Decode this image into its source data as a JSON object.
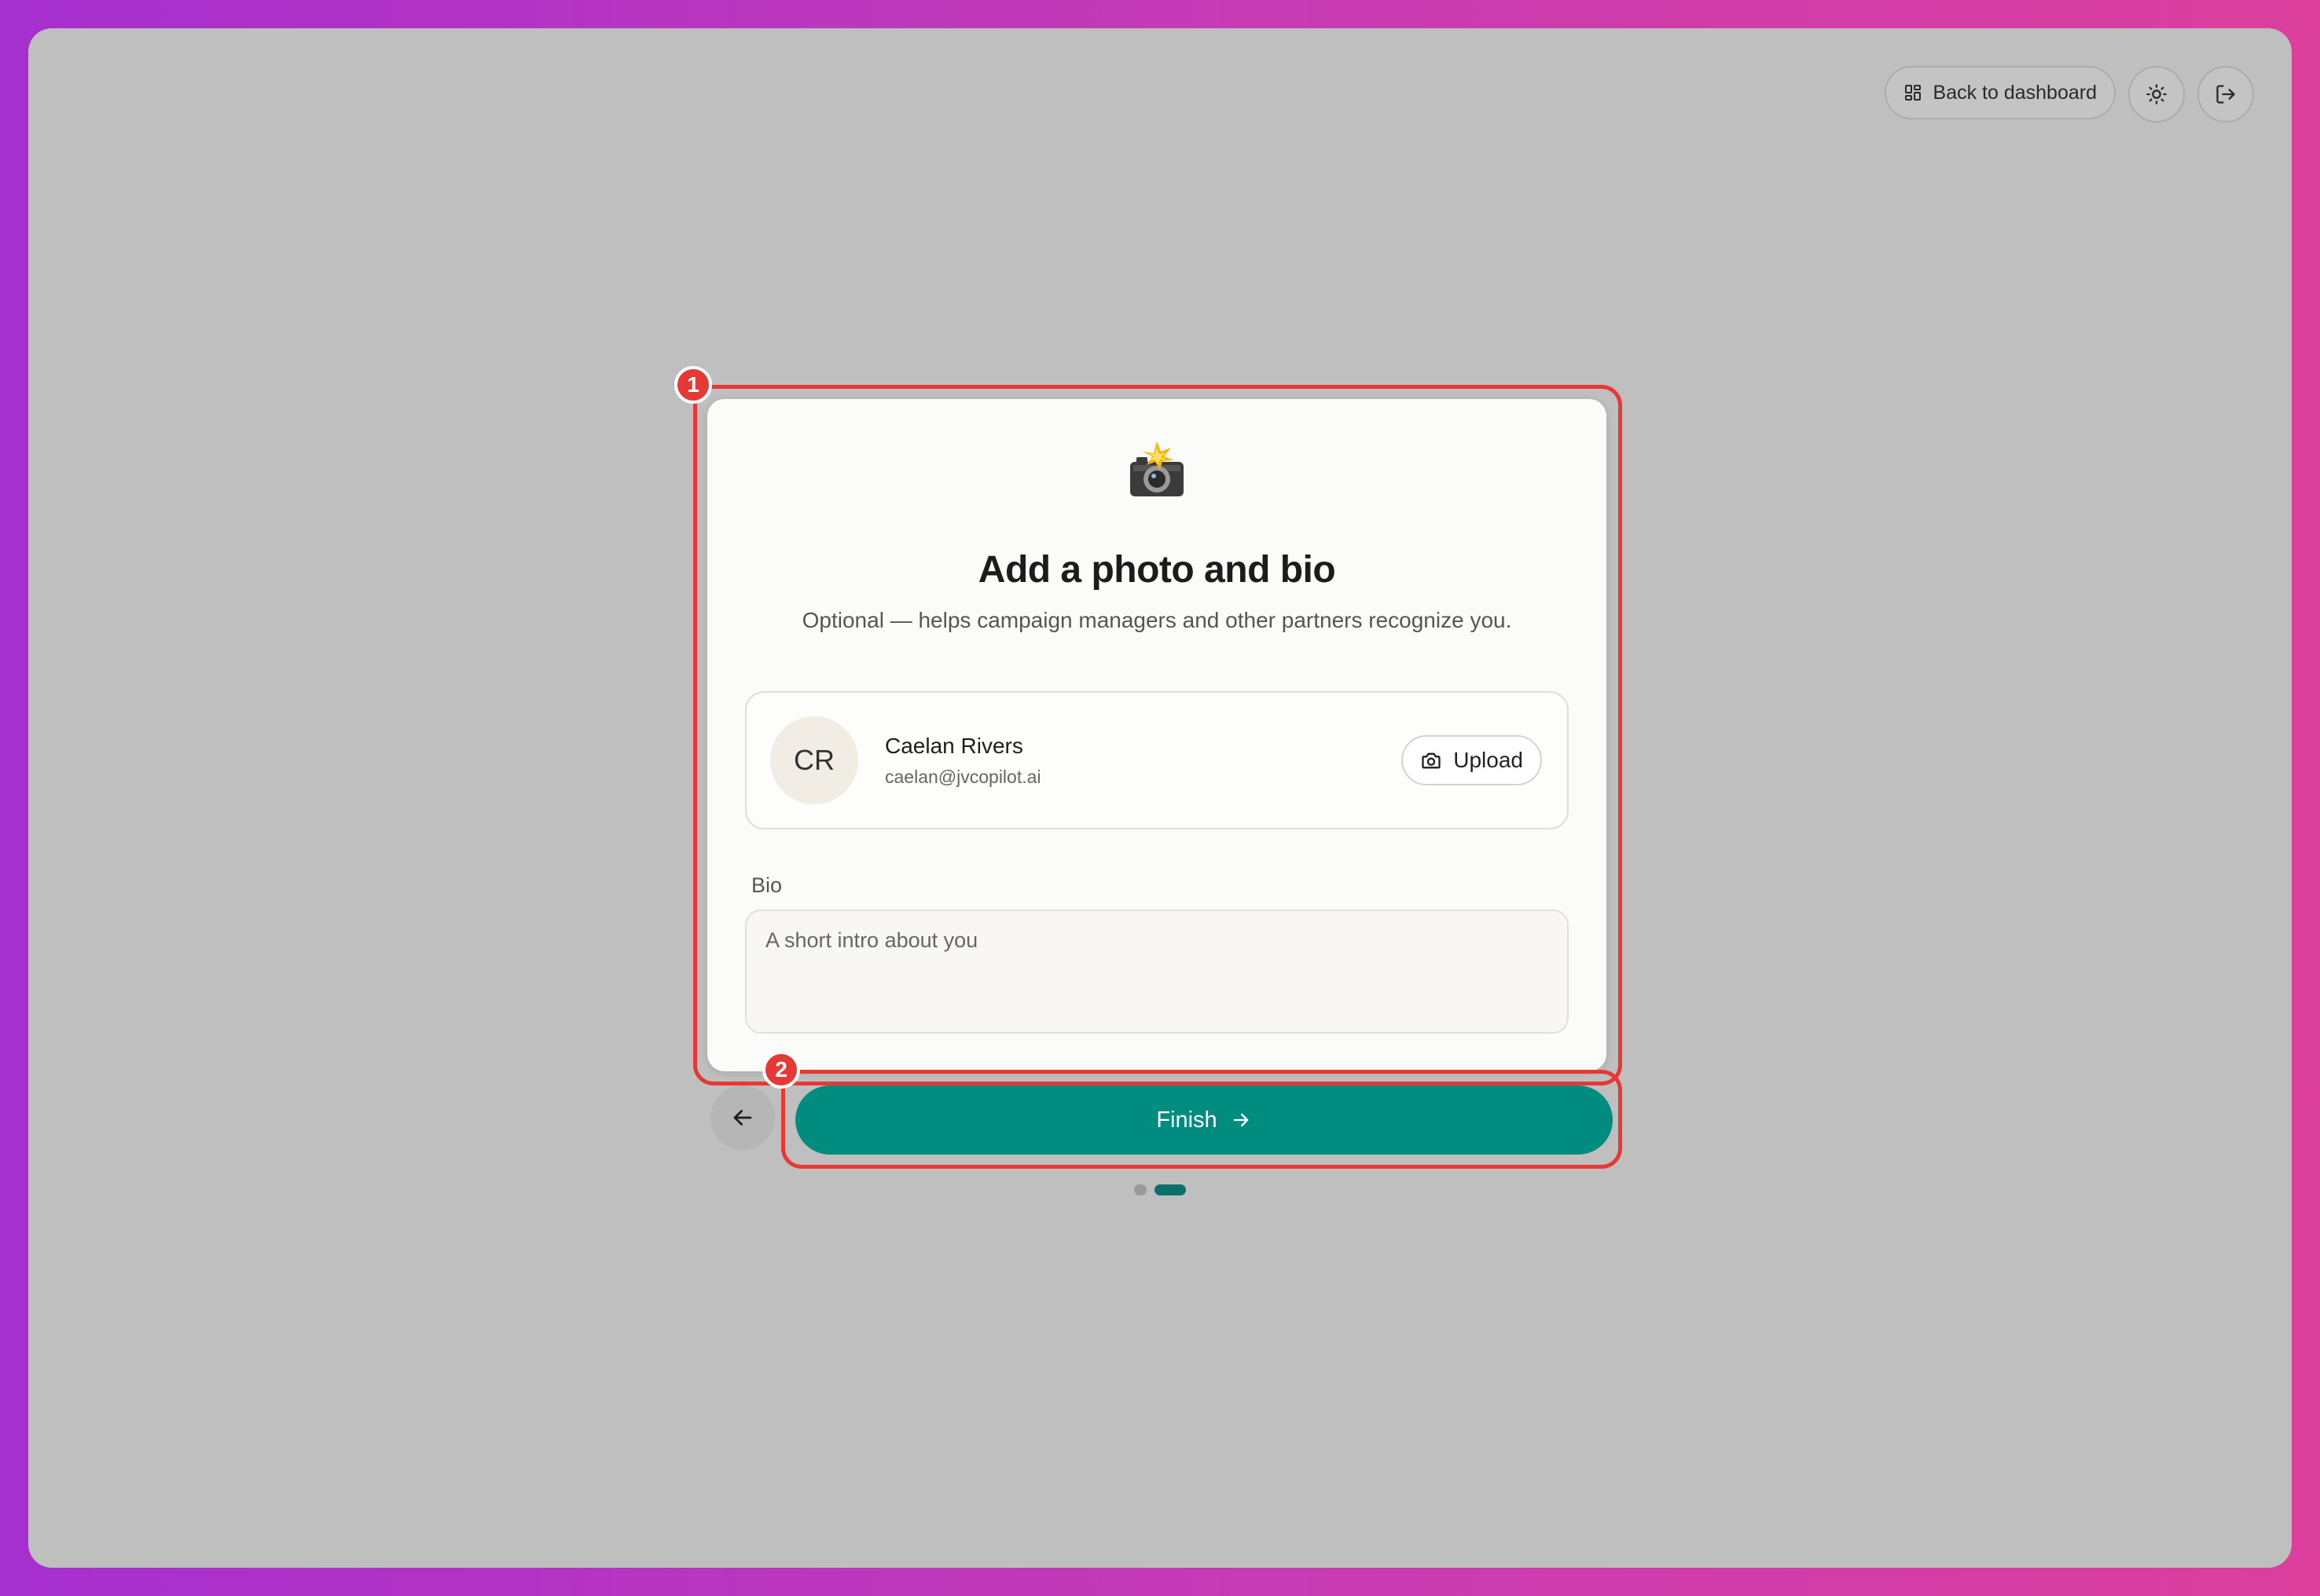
{
  "topbar": {
    "back_to_dashboard": "Back to dashboard",
    "theme_toggle_icon": "sun-icon",
    "logout_icon": "logout-icon"
  },
  "annotations": {
    "badge_1": "1",
    "badge_2": "2",
    "color": "#e53935"
  },
  "card": {
    "emoji": "📸",
    "title": "Add a photo and bio",
    "subtitle": "Optional — helps campaign managers and other partners recognize you."
  },
  "profile": {
    "initials": "CR",
    "name": "Caelan Rivers",
    "email": "caelan@jvcopilot.ai",
    "upload_label": "Upload"
  },
  "bio": {
    "label": "Bio",
    "placeholder": "A short intro about you",
    "value": ""
  },
  "actions": {
    "finish_label": "Finish",
    "back_icon": "arrow-left-icon",
    "finish_icon": "arrow-right-icon"
  },
  "progress": {
    "steps": 2,
    "current": 2
  },
  "colors": {
    "accent": "#008c7e",
    "active_dot": "#0b706a",
    "window_bg": "#bfbfbf"
  }
}
